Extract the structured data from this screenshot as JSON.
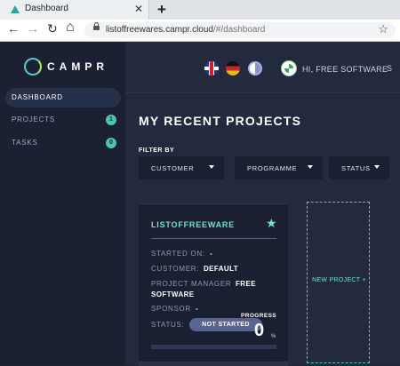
{
  "browser": {
    "tab_title": "Dashboard",
    "tab_close": "✕",
    "new_tab": "+",
    "back": "←",
    "forward": "→",
    "reload": "↻",
    "home": "⌂",
    "url_host": "listoffreewares.campr.cloud",
    "url_path": "/#/dashboard",
    "bookmark": "☆"
  },
  "brand": {
    "name": "CAMPR",
    "accent": "#5ec8c3",
    "accent2": "#b6ec64"
  },
  "sidebar": {
    "items": [
      {
        "label": "DASHBOARD",
        "active": true
      },
      {
        "label": "PROJECTS",
        "count": "1"
      },
      {
        "label": "TASKS",
        "count": "0"
      }
    ]
  },
  "header": {
    "user_label": "HI, FREE SOFTWARE",
    "user_caret": "S",
    "icons": [
      "flag-en-icon",
      "flag-de-icon",
      "contrast-icon",
      "avatar"
    ]
  },
  "page": {
    "title": "MY RECENT PROJECTS",
    "filter_by": "FILTER BY",
    "filters": [
      "CUSTOMER",
      "PROGRAMME",
      "STATUS"
    ]
  },
  "project": {
    "name": "LISTOFFREEWARE",
    "favorite": "★",
    "started_on_label": "STARTED ON:",
    "started_on_value": "-",
    "customer_label": "CUSTOMER:",
    "customer_value": "DEFAULT",
    "manager_label": "PROJECT MANAGER",
    "manager_value_1": "FREE",
    "manager_value_2": "SOFTWARE",
    "sponsor_label": "SPONSOR",
    "sponsor_value": "-",
    "status_label": "STATUS:",
    "status_value": "NOT STARTED",
    "progress_label": "PROGRESS",
    "progress_value": "0",
    "progress_unit": "%",
    "progress_fraction": 0
  },
  "new_project": {
    "label": "NEW PROJECT +"
  }
}
